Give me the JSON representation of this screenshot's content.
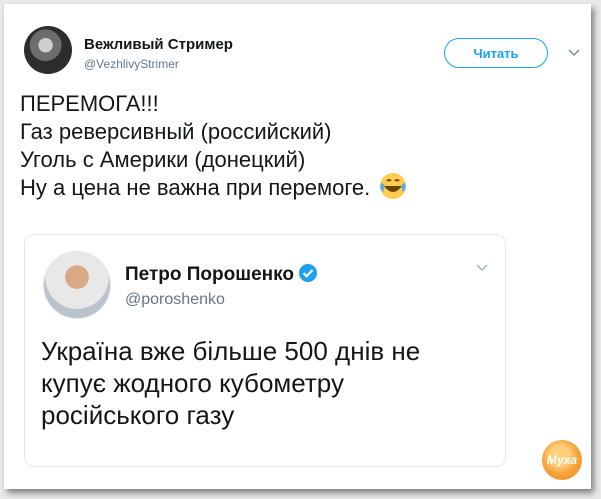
{
  "tweet": {
    "author_name": "Вежливый Стример",
    "author_handle": "@VezhlivyStrimer",
    "follow_label": "Читать",
    "lines": [
      "ПЕРЕМОГА!!!",
      "Газ реверсивный (российский)",
      "Уголь с Америки (донецкий)",
      "Ну а цена не важна при перемоге."
    ],
    "emoji": "face-with-tears-of-joy"
  },
  "quoted_tweet": {
    "author_name": "Петро Порошенко",
    "author_handle": "@poroshenko",
    "verified": true,
    "lines": [
      "Україна вже більше 500 днів не",
      "купує жодного кубометру",
      "російського газу"
    ]
  },
  "watermark": {
    "text": "Муха"
  },
  "colors": {
    "accent": "#1da1f2",
    "text": "#14171a",
    "muted": "#657786",
    "border": "#e1e8ed"
  }
}
